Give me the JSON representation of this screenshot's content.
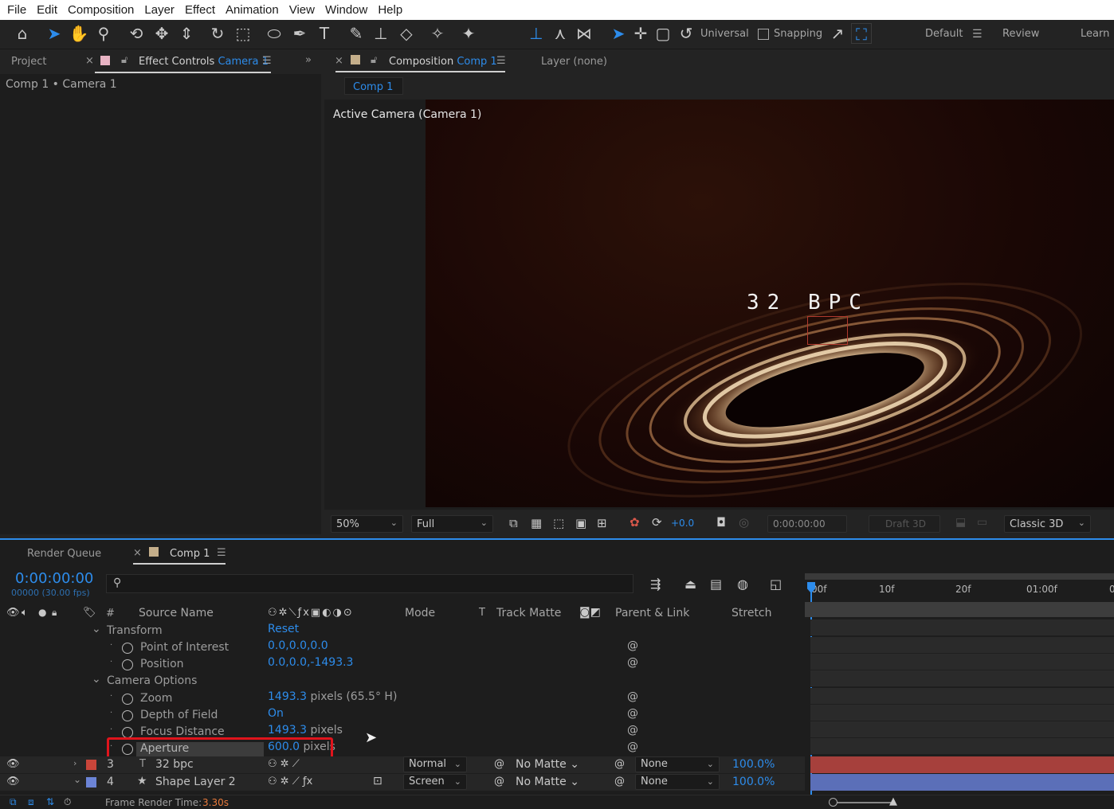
{
  "menu": [
    "File",
    "Edit",
    "Composition",
    "Layer",
    "Effect",
    "Animation",
    "View",
    "Window",
    "Help"
  ],
  "toolbar": {
    "universal_label": "Universal",
    "snapping_label": "Snapping",
    "workspace_default": "Default",
    "workspace_review": "Review",
    "workspace_learn": "Learn"
  },
  "left_panel": {
    "tab_project": "Project",
    "tab_effect_controls": "Effect Controls",
    "tab_effect_controls_target": "Camera 1",
    "breadcrumb": "Comp 1 • Camera 1"
  },
  "comp_panel": {
    "tab_composition": "Composition",
    "tab_composition_target": "Comp 1",
    "tab_layer": "Layer (none)",
    "subtab": "Comp 1",
    "viewer_label": "Active Camera (Camera 1)",
    "canvas_text": "32 BPC"
  },
  "viewer_bar": {
    "zoom": "50%",
    "resolution": "Full",
    "exposure": "+0.0",
    "timecode": "0:00:00:00",
    "draft3d": "Draft 3D",
    "renderer": "Classic 3D"
  },
  "timeline": {
    "tab_render_queue": "Render Queue",
    "tab_comp": "Comp 1",
    "timecode": "0:00:00:00",
    "frames_fps": "00000 (30.00 fps)",
    "ruler": [
      "00f",
      "10f",
      "20f",
      "01:00f",
      "0"
    ],
    "columns": {
      "number": "#",
      "source_name": "Source Name",
      "mode": "Mode",
      "t": "T",
      "track_matte": "Track Matte",
      "parent_link": "Parent & Link",
      "stretch": "Stretch"
    },
    "properties": {
      "transform_label": "Transform",
      "transform_reset": "Reset",
      "point_of_interest_label": "Point of Interest",
      "point_of_interest_value": "0.0,0.0,0.0",
      "position_label": "Position",
      "position_value": "0.0,0.0,-1493.3",
      "camera_options_label": "Camera Options",
      "zoom_label": "Zoom",
      "zoom_value": "1493.3",
      "zoom_unit": "pixels (65.5° H)",
      "dof_label": "Depth of Field",
      "dof_value": "On",
      "focus_label": "Focus Distance",
      "focus_value": "1493.3",
      "focus_unit": "pixels",
      "aperture_label": "Aperture",
      "aperture_value": "600.0",
      "aperture_unit": "pixels"
    },
    "layers": [
      {
        "number": "3",
        "name": "32 bpc",
        "mode": "Normal",
        "matte": "No Matte",
        "parent": "None",
        "stretch": "100.0%",
        "color": "#c9453a"
      },
      {
        "number": "4",
        "name": "Shape Layer 2",
        "mode": "Screen",
        "matte": "No Matte",
        "parent": "None",
        "stretch": "100.0%",
        "color": "#6c84d6"
      }
    ],
    "frame_render_label": "Frame Render Time:",
    "frame_render_value": "3.30s"
  },
  "colors": {
    "accent": "#2d8ceb",
    "highlight_box": "#e0141c",
    "layer3_bar": "#a6403c",
    "layer4_bar": "#5b6fb8"
  }
}
